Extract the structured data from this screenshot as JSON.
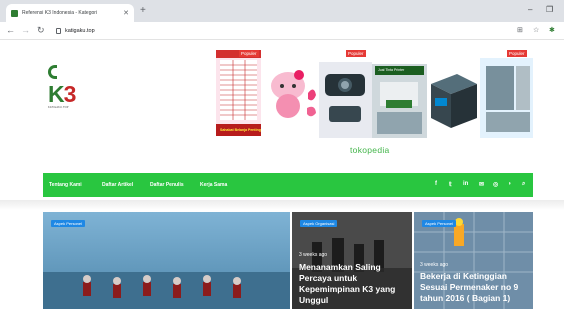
{
  "browser": {
    "tab_title": "Referensi K3 Indonesia - Kategori",
    "new_tab": "+",
    "url": "katigaku.top",
    "minimize": "–",
    "maximize": "❐"
  },
  "logo": {
    "text_k": "K",
    "text_3": "3",
    "tagline": "KATIGAKU.TOP"
  },
  "ad": {
    "badge_left": "Populer",
    "badge_mid": "Populer",
    "badge_right": "Populer",
    "sticker_text": "Jual Tinta Printer",
    "bottom_text": "Sahabat Belanja Penting"
  },
  "tokopedia": "tokopedia",
  "nav": {
    "items": [
      "Tentang Kami",
      "Daftar Artikel",
      "Daftar Penulis",
      "Kerja Sama"
    ],
    "social_icons": [
      "facebook-icon",
      "twitter-icon",
      "linkedin-icon",
      "email-icon",
      "instagram-icon",
      "rss-icon",
      "search-icon"
    ],
    "bg_color": "#29c640"
  },
  "posts": [
    {
      "badge": "Aspek Personel",
      "time": "",
      "title": ""
    },
    {
      "badge": "Aspek Organisasi",
      "time": "3 weeks ago",
      "title": "Menanamkan Saling Percaya untuk Kepemimpinan K3 yang Unggul"
    },
    {
      "badge": "Aspek Personel",
      "time": "3 weeks ago",
      "title": "Bekerja di Ketinggian Sesuai Permenaker no 9 tahun 2016 ( Bagian 1)"
    }
  ],
  "colors": {
    "accent": "#29c640",
    "badge": "#1e88e5"
  }
}
